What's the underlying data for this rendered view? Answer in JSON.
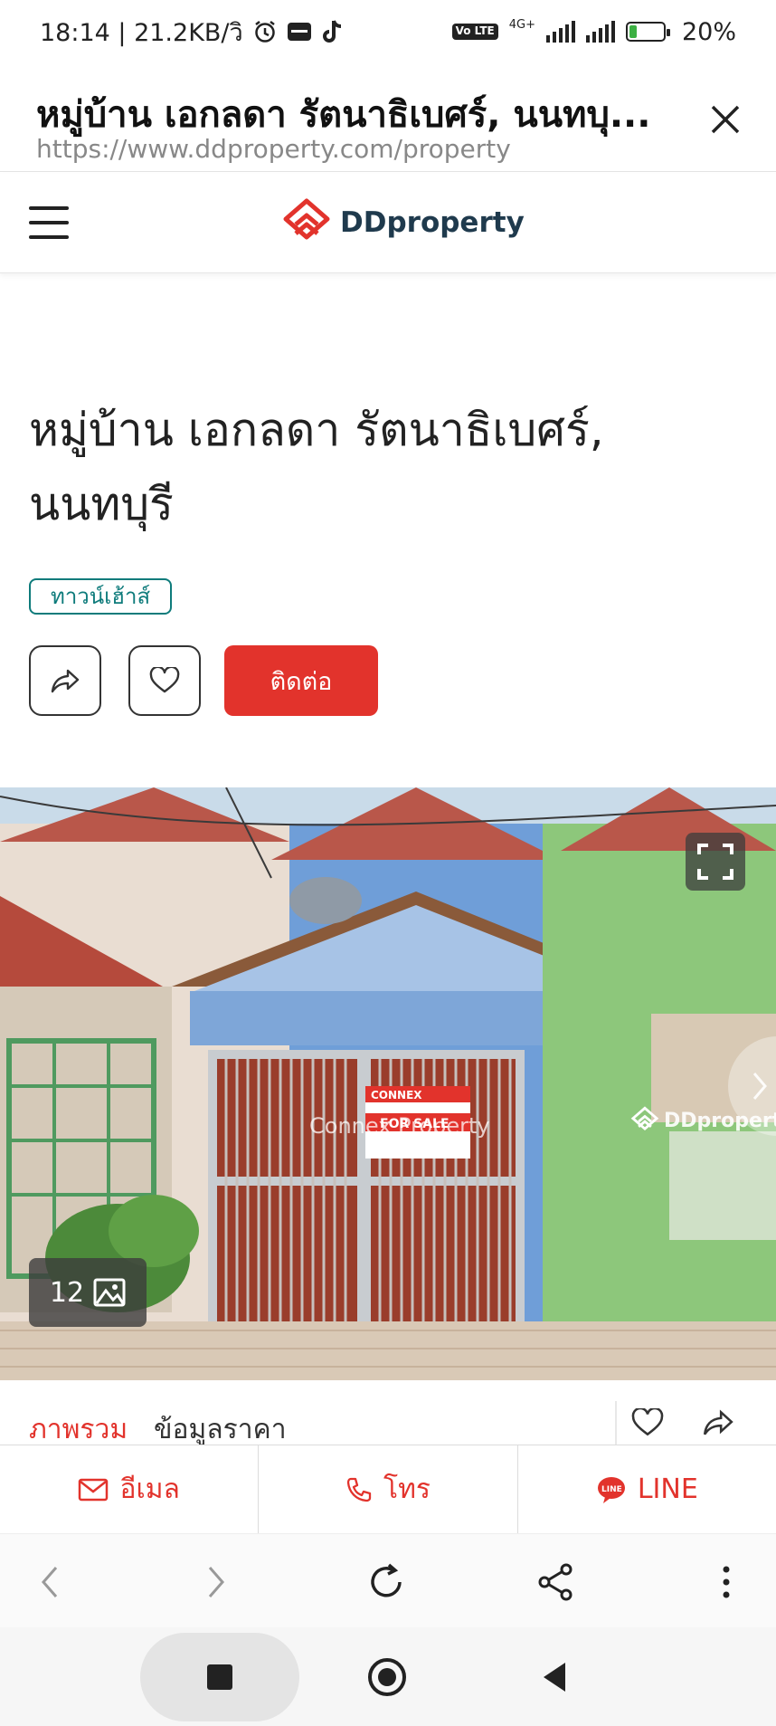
{
  "status_bar": {
    "time_network": "18:14 | 21.2KB/วิ",
    "volte_label": "Vo LTE",
    "network_label": "4G+",
    "battery_percent": "20%",
    "battery_level": 0.2,
    "icons": [
      "alarm-icon",
      "app-notification-icon",
      "tiktok-icon",
      "signal-icon",
      "battery-charging-icon"
    ]
  },
  "browser": {
    "page_title": "หมู่บ้าน เอกลดา รัตนาธิเบศร์, นนทบุ...",
    "url": "https://www.ddproperty.com/property"
  },
  "site_header": {
    "brand": "DDproperty",
    "brand_color": "#e2332c"
  },
  "listing": {
    "title": "หมู่บ้าน เอกลดา รัตนาธิเบศร์, นนทบุรี",
    "type_badge": "ทาวน์เฮ้าส์",
    "contact_button": "ติดต่อ"
  },
  "photo": {
    "count": "12",
    "watermark_center": "Connex Property",
    "watermark_right": "DDproperty",
    "sign_brand": "CONNEX",
    "sign_text": "FOR SALE"
  },
  "tabs": [
    {
      "label": "ภาพรวม",
      "active": true
    },
    {
      "label": "ข้อมูลราคา",
      "active": false
    }
  ],
  "contact_bar": {
    "email_label": "อีเมล",
    "call_label": "โทร",
    "line_label": "LINE"
  },
  "colors": {
    "accent": "#e2332c",
    "badge": "#0e7b7b"
  }
}
